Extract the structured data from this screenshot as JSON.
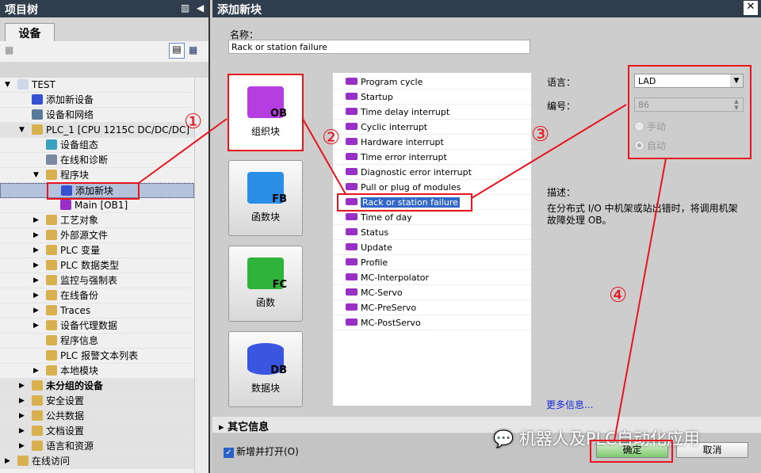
{
  "project_tree": {
    "title": "项目树",
    "tab": "设备",
    "items": [
      {
        "label": "TEST",
        "level": 0,
        "expand": "open"
      },
      {
        "label": "添加新设备",
        "level": 1
      },
      {
        "label": "设备和网络",
        "level": 1
      },
      {
        "label": "PLC_1 [CPU 1215C DC/DC/DC]",
        "level": 1,
        "expand": "open"
      },
      {
        "label": "设备组态",
        "level": 2
      },
      {
        "label": "在线和诊断",
        "level": 2
      },
      {
        "label": "程序块",
        "level": 2,
        "expand": "open"
      },
      {
        "label": "添加新块",
        "level": 3,
        "selected": true
      },
      {
        "label": "Main [OB1]",
        "level": 3
      },
      {
        "label": "工艺对象",
        "level": 2,
        "expand": "closed"
      },
      {
        "label": "外部源文件",
        "level": 2,
        "expand": "closed"
      },
      {
        "label": "PLC 变量",
        "level": 2,
        "expand": "closed"
      },
      {
        "label": "PLC 数据类型",
        "level": 2,
        "expand": "closed"
      },
      {
        "label": "监控与强制表",
        "level": 2,
        "expand": "closed"
      },
      {
        "label": "在线备份",
        "level": 2,
        "expand": "closed"
      },
      {
        "label": "Traces",
        "level": 2,
        "expand": "closed"
      },
      {
        "label": "设备代理数据",
        "level": 2,
        "expand": "closed"
      },
      {
        "label": "程序信息",
        "level": 2
      },
      {
        "label": "PLC 报警文本列表",
        "level": 2
      },
      {
        "label": "本地模块",
        "level": 2,
        "expand": "closed"
      },
      {
        "label": "未分组的设备",
        "level": 1,
        "expand": "closed",
        "bold": true
      },
      {
        "label": "安全设置",
        "level": 1,
        "expand": "closed"
      },
      {
        "label": "公共数据",
        "level": 1,
        "expand": "closed"
      },
      {
        "label": "文档设置",
        "level": 1,
        "expand": "closed"
      },
      {
        "label": "语言和资源",
        "level": 1,
        "expand": "closed"
      },
      {
        "label": "在线访问",
        "level": 0,
        "expand": "closed"
      }
    ]
  },
  "dialog": {
    "title": "添加新块",
    "name_label": "名称：",
    "name_value": "Rack or station failure",
    "blocks": [
      {
        "label": "组织块",
        "code": "OB",
        "color": "#b63de0"
      },
      {
        "label": "函数块",
        "code": "FB",
        "color": "#2a8ee6"
      },
      {
        "label": "函数",
        "code": "FC",
        "color": "#2fb33a"
      },
      {
        "label": "数据块",
        "code": "DB",
        "color": "#3a55e0"
      }
    ],
    "ob_list": [
      "Program cycle",
      "Startup",
      "Time delay interrupt",
      "Cyclic interrupt",
      "Hardware interrupt",
      "Time error interrupt",
      "Diagnostic error interrupt",
      "Pull or plug of modules",
      "Rack or station failure",
      "Time of day",
      "Status",
      "Update",
      "Profile",
      "MC-Interpolator",
      "MC-Servo",
      "MC-PreServo",
      "MC-PostServo"
    ],
    "selected_ob": "Rack or station failure",
    "language_label": "语言：",
    "language_value": "LAD",
    "number_label": "编号：",
    "number_value": "86",
    "manual_label": "手动",
    "auto_label": "自动",
    "auto_selected": true,
    "description_label": "描述：",
    "description": "在分布式 I/O 中机架或站出错时，将调用机架故障处理 OB。",
    "more_info": "更多信息...",
    "other_info": "其它信息",
    "open_checkbox": "新增并打开(O)",
    "open_checked": true,
    "ok": "确定",
    "cancel": "取消"
  },
  "annotations": [
    "①",
    "②",
    "③",
    "④"
  ],
  "watermark": "机器人及PLC自动化应用"
}
